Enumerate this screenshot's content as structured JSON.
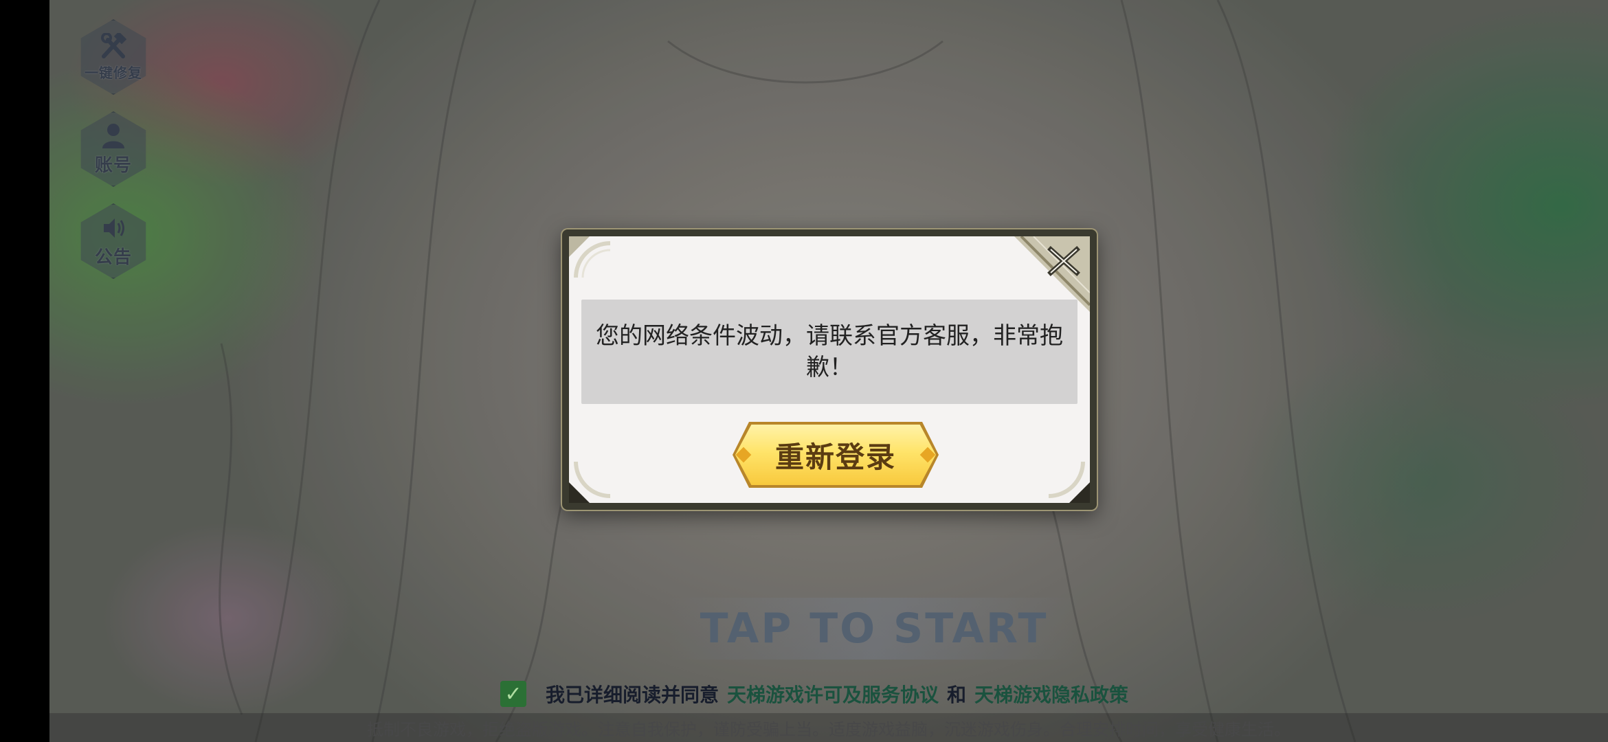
{
  "sidebar": {
    "repair_label": "一键修复",
    "account_label": "账号",
    "notice_label": "公告"
  },
  "start": {
    "tap_text": "TAP TO START"
  },
  "agreement": {
    "checked": true,
    "prefix": "我已详细阅读并同意",
    "license_link": "天梯游戏许可及服务协议",
    "and": "和",
    "privacy_link": "天梯游戏隐私政策"
  },
  "health_notice": "抵制不良游戏，拒绝盗版游戏。注意自我保护，谨防受骗上当。适度游戏益脑，沉迷游戏伤身。合理安排时间，享受健康生活。",
  "dialog": {
    "message": "您的网络条件波动，请联系官方客服，非常抱歉！",
    "button_label": "重新登录",
    "close_icon": "close-x-icon"
  },
  "colors": {
    "button_gold": "#ffe46a",
    "button_text": "#5b3c12",
    "dialog_frame": "#3a3a2f",
    "checkbox": "#2f7a3a"
  }
}
